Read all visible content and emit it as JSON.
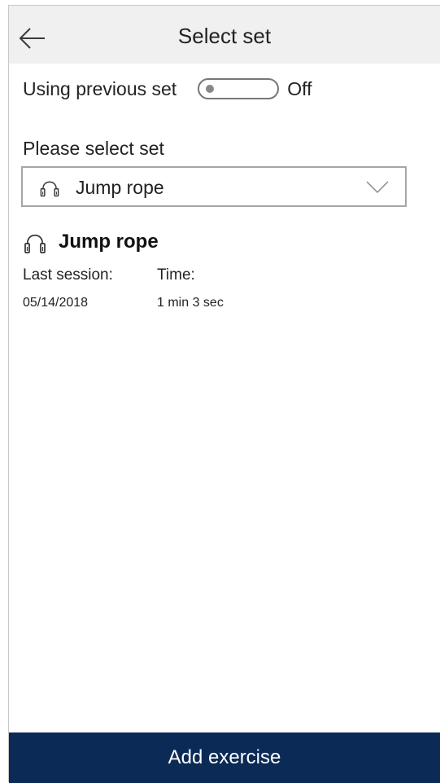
{
  "header": {
    "title": "Select set",
    "back_icon": "arrow-left-icon"
  },
  "previous_set": {
    "label": "Using previous set",
    "toggle_state": "Off"
  },
  "set_select": {
    "label": "Please select set",
    "selected_value": "Jump rope",
    "icon": "jump-rope-icon"
  },
  "set_details": {
    "name": "Jump rope",
    "icon": "jump-rope-icon",
    "last_session_label": "Last session:",
    "time_label": "Time:",
    "last_session_value": "05/14/2018",
    "time_value": "1 min 3 sec"
  },
  "footer": {
    "add_label": "Add exercise"
  },
  "colors": {
    "header_bg": "#f0f0f0",
    "primary_button": "#0b2a56"
  }
}
